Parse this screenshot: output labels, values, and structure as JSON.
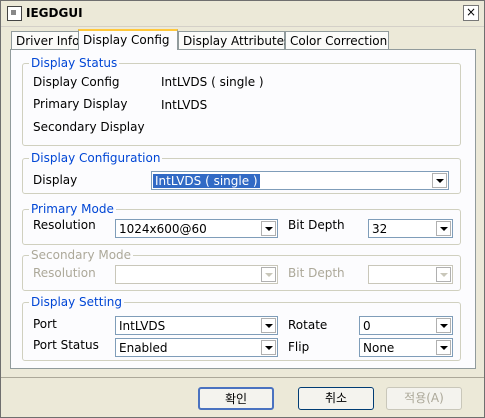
{
  "window": {
    "title": "IEGDGUI",
    "close_glyph": "×"
  },
  "tabs": [
    {
      "label": "Driver Info"
    },
    {
      "label": "Display Config"
    },
    {
      "label": "Display Attributes"
    },
    {
      "label": "Color Correction"
    }
  ],
  "display_status": {
    "title": "Display Status",
    "display_config_label": "Display Config",
    "display_config_value": "IntLVDS ( single )",
    "primary_display_label": "Primary Display",
    "primary_display_value": "IntLVDS",
    "secondary_display_label": "Secondary Display"
  },
  "display_configuration": {
    "title": "Display Configuration",
    "display_label": "Display",
    "display_value": "IntLVDS ( single )"
  },
  "primary_mode": {
    "title": "Primary Mode",
    "resolution_label": "Resolution",
    "resolution_value": "1024x600@60",
    "bit_depth_label": "Bit Depth",
    "bit_depth_value": "32"
  },
  "secondary_mode": {
    "title": "Secondary Mode",
    "resolution_label": "Resolution",
    "bit_depth_label": "Bit Depth"
  },
  "display_setting": {
    "title": "Display Setting",
    "port_label": "Port",
    "port_value": "IntLVDS",
    "rotate_label": "Rotate",
    "rotate_value": "0",
    "port_status_label": "Port Status",
    "port_status_value": "Enabled",
    "flip_label": "Flip",
    "flip_value": "None"
  },
  "buttons": {
    "ok": "확인",
    "cancel": "취소",
    "apply": "적용(A)"
  }
}
